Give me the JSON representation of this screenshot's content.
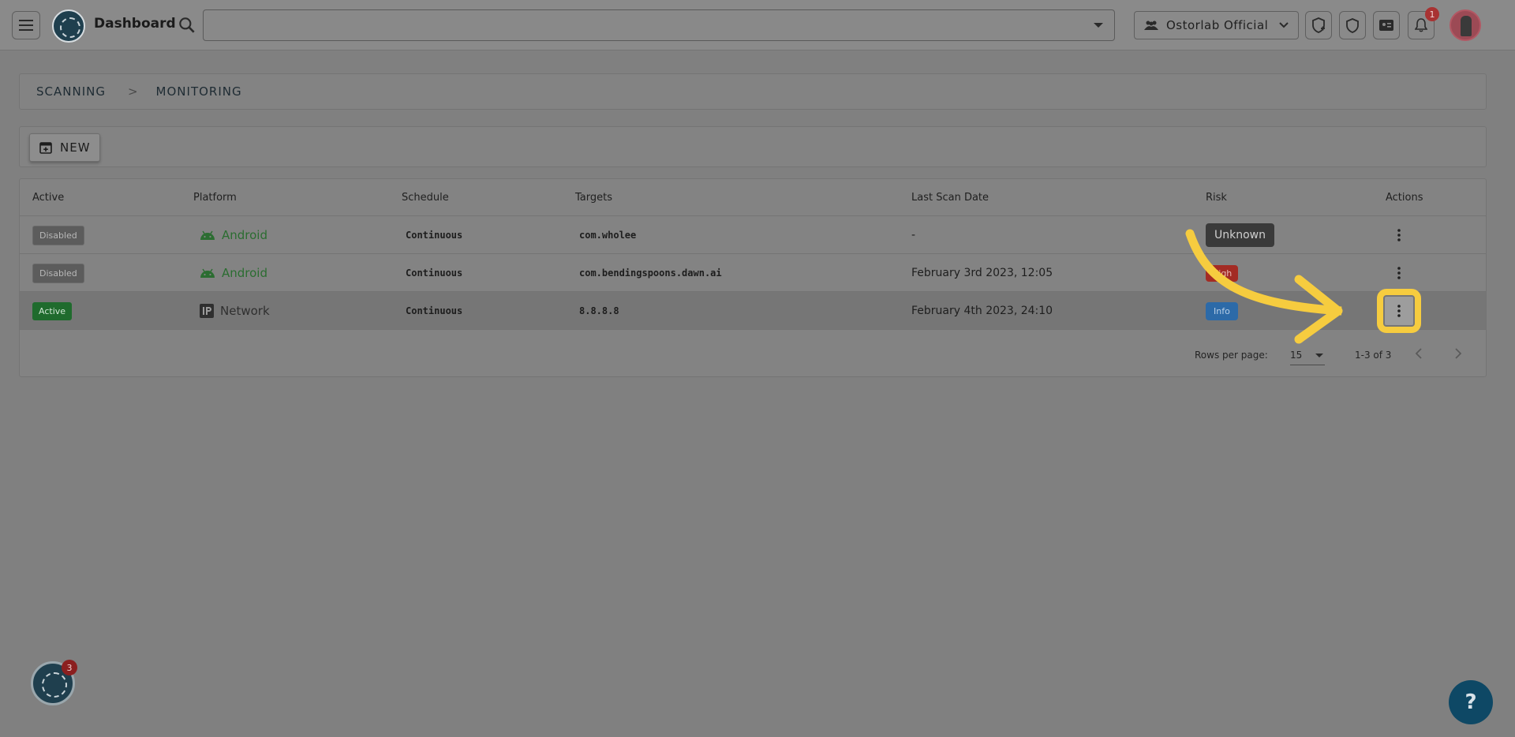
{
  "header": {
    "title": "Dashboard",
    "search": {
      "value": "",
      "placeholder": ""
    },
    "organization": "Ostorlab Official",
    "notifications_count": "1"
  },
  "breadcrumb": {
    "items": [
      "SCANNING",
      "MONITORING"
    ],
    "separator": ">"
  },
  "toolbar": {
    "new_label": "NEW"
  },
  "table": {
    "columns": {
      "active": "Active",
      "platform": "Platform",
      "schedule": "Schedule",
      "targets": "Targets",
      "last_scan": "Last Scan Date",
      "risk": "Risk",
      "actions": "Actions"
    },
    "rows": [
      {
        "active": "Disabled",
        "platform": "Android",
        "schedule": "Continuous",
        "target": "com.wholee",
        "last_scan": "-",
        "risk": "Unknown"
      },
      {
        "active": "Disabled",
        "platform": "Android",
        "schedule": "Continuous",
        "target": "com.bendingspoons.dawn.ai",
        "last_scan": "February 3rd 2023, 12:05",
        "risk": "High"
      },
      {
        "active": "Active",
        "platform": "Network",
        "schedule": "Continuous",
        "target": "8.8.8.8",
        "last_scan": "February 4th 2023, 24:10",
        "risk": "Info"
      }
    ],
    "pagination": {
      "rows_per_page_label": "Rows per page:",
      "rows_per_page": "15",
      "range": "1-3 of 3"
    }
  },
  "float": {
    "badge_count": "3",
    "help_label": "?"
  },
  "colors": {
    "highlight": "#f6cc3f",
    "android": "#2b6d31",
    "active": "#1f6b2d",
    "risk_high": "#a32b24",
    "risk_info": "#2c6aa8",
    "help": "#0e4865"
  },
  "icons": [
    "menu-icon",
    "search-icon",
    "group-icon",
    "chevron-down-icon",
    "shield-plus-icon",
    "shield-icon",
    "id-card-icon",
    "bell-icon",
    "calendar-add-icon",
    "android-icon",
    "ip-icon",
    "more-vert-icon",
    "chevron-left-icon",
    "chevron-right-icon"
  ]
}
